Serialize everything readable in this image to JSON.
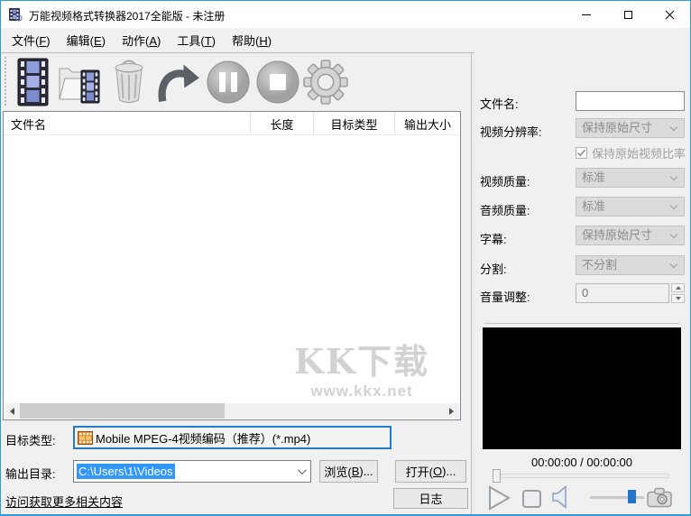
{
  "window": {
    "title": "万能视频格式转换器2017全能版 - 未注册",
    "controls": [
      "minimize",
      "maximize",
      "close"
    ]
  },
  "menu": {
    "items": [
      "文件(F)",
      "编辑(E)",
      "动作(A)",
      "工具(T)",
      "帮助(H)"
    ]
  },
  "toolbar": {
    "buttons": [
      {
        "icon": "add-file-film-icon"
      },
      {
        "icon": "add-folder-icon"
      },
      {
        "icon": "delete-trash-icon"
      },
      {
        "icon": "convert-arrow-icon"
      },
      {
        "icon": "pause-icon"
      },
      {
        "icon": "stop-icon"
      },
      {
        "icon": "settings-gear-icon"
      }
    ]
  },
  "file_list": {
    "columns": [
      "文件名",
      "长度",
      "目标类型",
      "输出大小"
    ],
    "rows": [],
    "watermark": {
      "line1": "KK下载",
      "line2": "www.kkx.net"
    }
  },
  "settings": {
    "filename_label": "文件名:",
    "filename_value": "",
    "resolution_label": "视频分辨率:",
    "resolution_value": "保持原始尺寸",
    "keep_ratio_label": "保持原始视频比率",
    "keep_ratio_checked": true,
    "video_quality_label": "视频质量:",
    "video_quality_value": "标准",
    "audio_quality_label": "音频质量:",
    "audio_quality_value": "标准",
    "subtitle_label": "字幕:",
    "subtitle_value": "保持原始尺寸",
    "split_label": "分割:",
    "split_value": "不分割",
    "volume_label": "音量调整:",
    "volume_value": "0"
  },
  "output": {
    "target_type_label": "目标类型:",
    "target_type_value": "Mobile MPEG-4视频编码（推荐）(*.mp4)",
    "output_dir_label": "输出目录:",
    "output_dir_value": "C:\\Users\\1\\Videos",
    "browse_button": "浏览(B)...",
    "open_button": "打开(O)...",
    "log_button": "日志",
    "more_link": "访问获取更多相关内容"
  },
  "player": {
    "time_display": "00:00:00 / 00:00:00",
    "controls": [
      "play-icon",
      "stop-icon",
      "speaker-icon",
      "volume-slider",
      "snapshot-camera-icon"
    ]
  },
  "colors": {
    "window_border": "#2f9bd8",
    "selection": "#3297fd",
    "target_combo_border": "#2678c8",
    "disabled_fill": "#dbdbdb",
    "watermark": "#d2d2d2"
  }
}
